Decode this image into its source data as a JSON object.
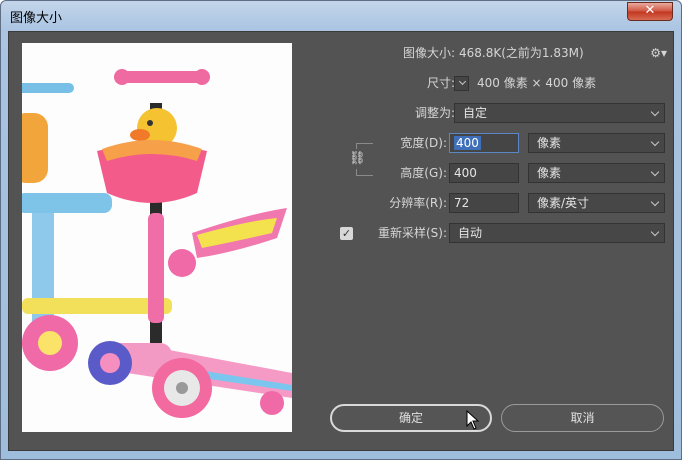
{
  "window": {
    "title": "图像大小",
    "close_glyph": "✕"
  },
  "info": {
    "image_size_label": "图像大小:",
    "image_size_value": "468.8K(之前为1.83M)",
    "dimensions_label": "尺寸:",
    "dimensions_value": "400 像素 × 400 像素"
  },
  "form": {
    "fit_to_label": "调整为:",
    "fit_to_value": "自定",
    "width_label": "宽度(D):",
    "width_value": "400",
    "width_unit": "像素",
    "height_label": "高度(G):",
    "height_value": "400",
    "height_unit": "像素",
    "resolution_label": "分辨率(R):",
    "resolution_value": "72",
    "resolution_unit": "像素/英寸",
    "resample_label": "重新采样(S):",
    "resample_checked": true,
    "resample_value": "自动"
  },
  "buttons": {
    "ok": "确定",
    "cancel": "取消"
  },
  "colors": {
    "panel": "#535353",
    "field": "#454545",
    "accent": "#3f6fb8"
  }
}
